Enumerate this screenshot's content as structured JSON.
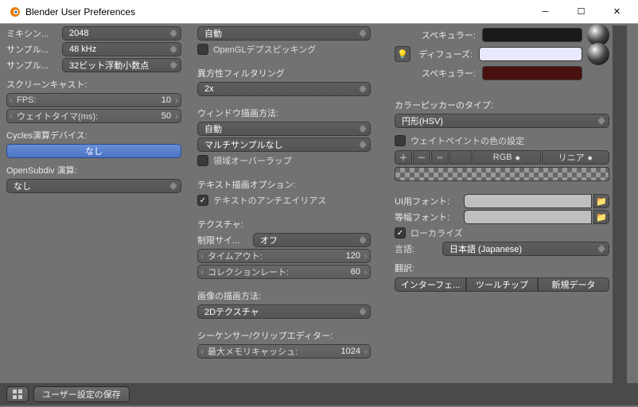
{
  "window": {
    "title": "Blender User Preferences"
  },
  "col1": {
    "mixing_label": "ミキシン...",
    "mixing_value": "2048",
    "sample_rate_label": "サンプル...",
    "sample_rate_value": "48 kHz",
    "sample_fmt_label": "サンプル...",
    "sample_fmt_value": "32ビット浮動小数点",
    "screencast": "スクリーンキャスト:",
    "fps_label": "FPS:",
    "fps_value": "10",
    "wait_label": "ウェイトタイマ(ms):",
    "wait_value": "50",
    "cycles": "Cycles演算デバイス:",
    "none": "なし",
    "opensubdiv": "OpenSubdiv 演算:",
    "opensubdiv_value": "なし"
  },
  "col2": {
    "auto": "自動",
    "opengl_depth": "OpenGLデプスピッキング",
    "aniso": "異方性フィルタリング",
    "aniso_value": "2x",
    "window_draw": "ウィンドウ描画方法:",
    "window_auto": "自動",
    "multisample": "マルチサンプルなし",
    "region_overlap": "領域オーバーラップ",
    "text_opts": "テキスト描画オプション:",
    "text_aa": "テキストのアンチエイリアス",
    "texture": "テクスチャ:",
    "limit_label": "制限サイ...",
    "limit_value": "オフ",
    "timeout_label": "タイムアウト:",
    "timeout_value": "120",
    "collection_label": "コレクションレート:",
    "collection_value": "60",
    "img_draw": "画像の描画方法:",
    "tex2d": "2Dテクスチャ",
    "seq": "シーケンサー/クリップエディター:",
    "mem_label": "最大メモリキャッシュ:",
    "mem_value": "1024"
  },
  "col3": {
    "specular1": "スペキュラー:",
    "diffuse": "ディフューズ:",
    "specular2": "スペキュラー:",
    "picker": "カラーピッカーのタイプ:",
    "picker_value": "円形(HSV)",
    "weight_paint": "ウェイトペイントの色の設定",
    "plus": "＋",
    "minus": "－",
    "arrows": "⇔",
    "rgb": "RGB",
    "linear": "リニア",
    "ui_font": "UI用フォント:",
    "mono_font": "等幅フォント:",
    "localize": "ローカライズ",
    "lang_label": "言語:",
    "lang_value": "日本語 (Japanese)",
    "translate": "翻訳:",
    "interface": "インターフェ...",
    "tooltip": "ツールチップ",
    "newdata": "新規データ"
  },
  "footer": {
    "save": "ユーザー設定の保存"
  },
  "colors": {
    "black": "#1a1a1a",
    "white": "#e8e8ff",
    "darkred": "#4a1010"
  }
}
